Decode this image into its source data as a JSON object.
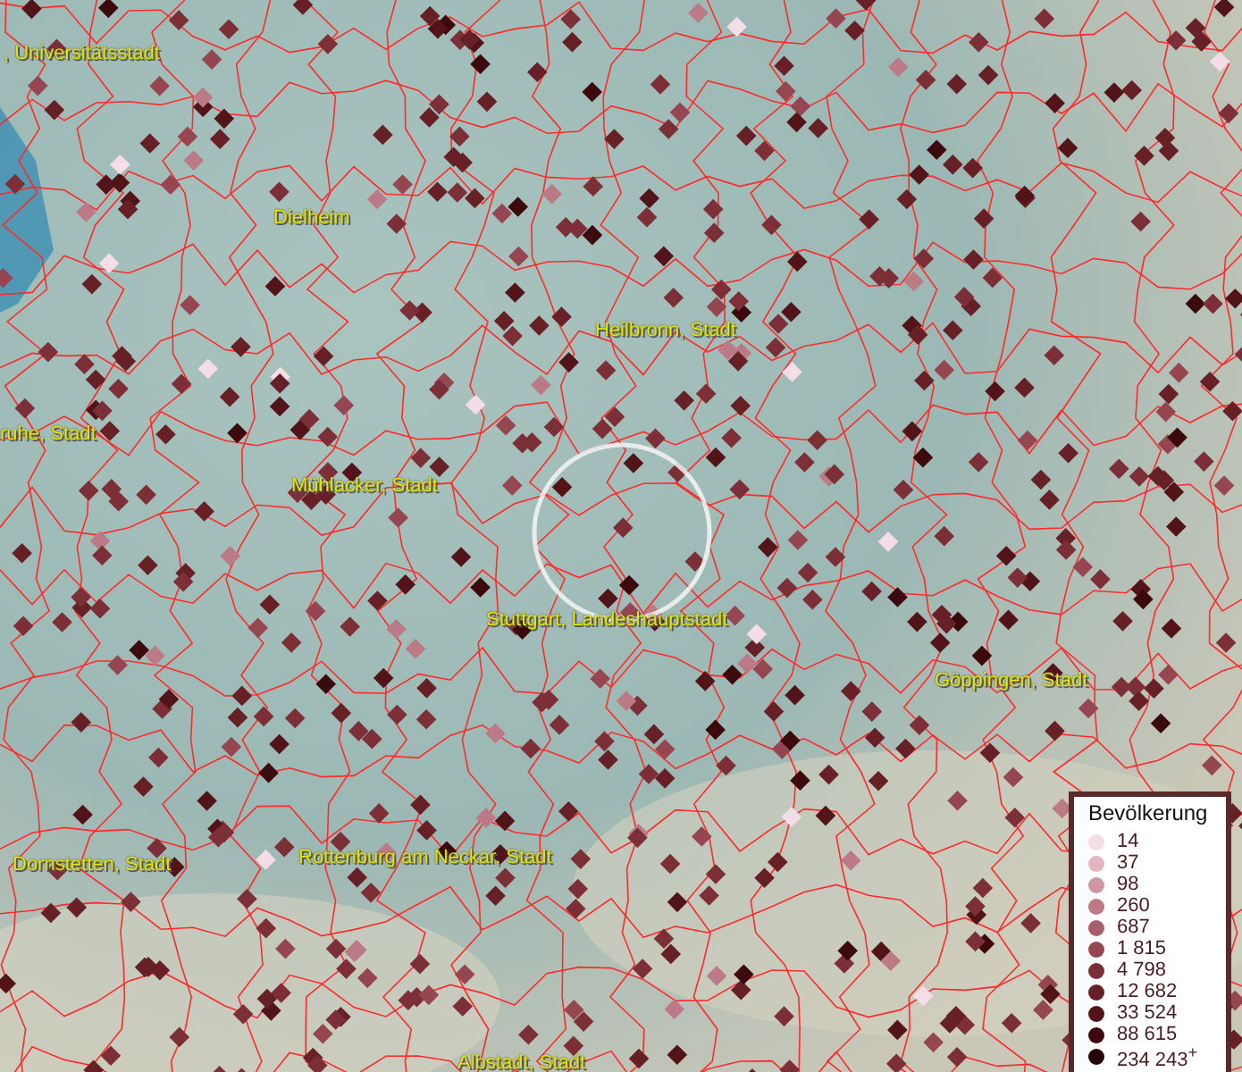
{
  "map": {
    "places": [
      {
        "name": ", Universitätsstadt"
      },
      {
        "name": "Dielheim"
      },
      {
        "name": "Heilbronn, Stadt"
      },
      {
        "name": "ruhe, Stadt"
      },
      {
        "name": "Mühlacker, Stadt"
      },
      {
        "name": "Stuttgart, Landeshauptstadt"
      },
      {
        "name": "Göppingen, Stadt"
      },
      {
        "name": "Dornstetten, Stadt"
      },
      {
        "name": "Rottenburg am Neckar, Stadt"
      },
      {
        "name": "Albstadt, Stadt"
      }
    ]
  },
  "legend": {
    "title": "Bevölkerung",
    "items": [
      {
        "label": "14",
        "color": "#f5dde8"
      },
      {
        "label": "37",
        "color": "#e3b5c0"
      },
      {
        "label": "98",
        "color": "#cf96a2"
      },
      {
        "label": "260",
        "color": "#bb7a86"
      },
      {
        "label": "687",
        "color": "#a85e6a"
      },
      {
        "label": "1 815",
        "color": "#954650"
      },
      {
        "label": "4 798",
        "color": "#7d2f38"
      },
      {
        "label": "12 682",
        "color": "#672026"
      },
      {
        "label": "33 524",
        "color": "#521419"
      },
      {
        "label": "88 615",
        "color": "#3c0a0d"
      },
      {
        "label": "234 243$^{+}$",
        "color": "#250406"
      }
    ]
  }
}
